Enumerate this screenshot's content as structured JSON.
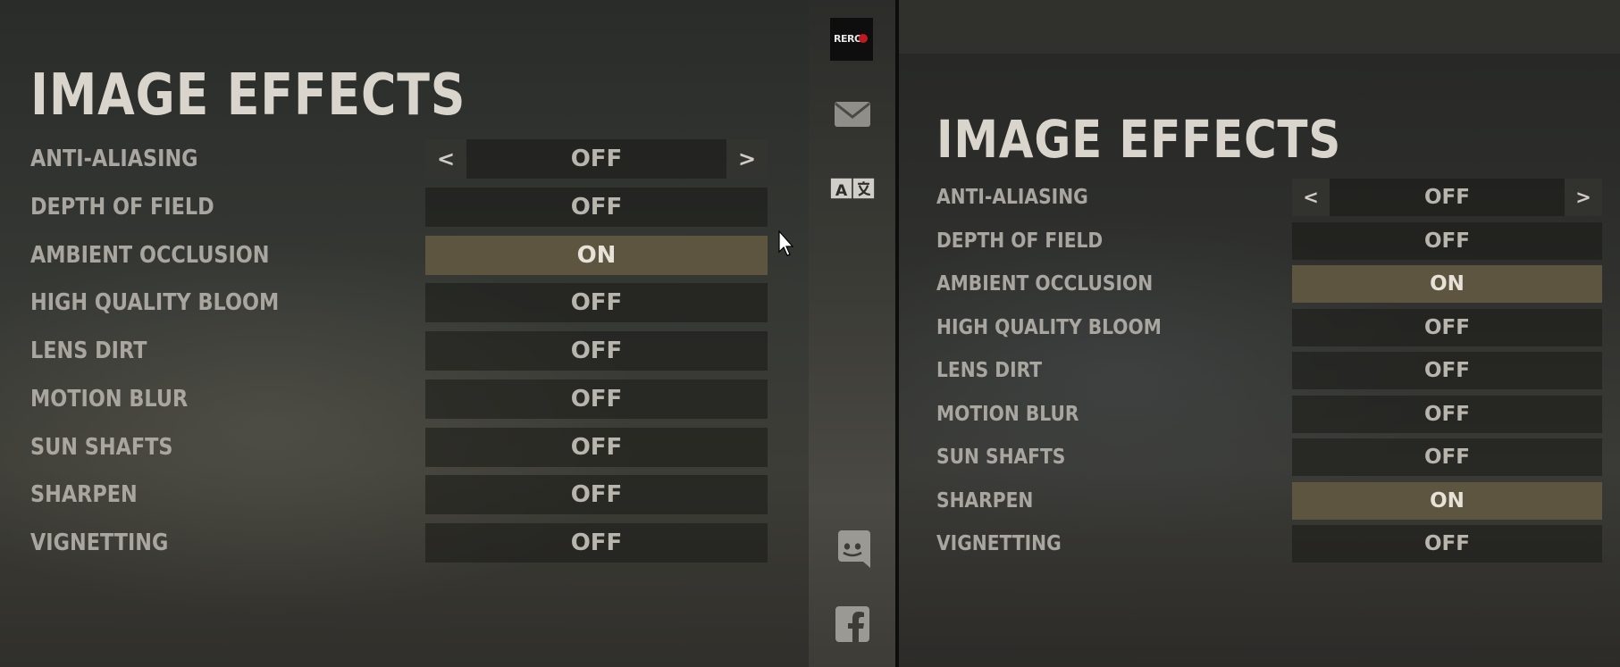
{
  "left": {
    "title": "IMAGE EFFECTS",
    "settings": [
      {
        "label": "ANTI-ALIASING",
        "value": "OFF",
        "arrows": true,
        "on": false
      },
      {
        "label": "DEPTH OF FIELD",
        "value": "OFF",
        "arrows": false,
        "on": false
      },
      {
        "label": "AMBIENT OCCLUSION",
        "value": "ON",
        "arrows": false,
        "on": true
      },
      {
        "label": "HIGH QUALITY BLOOM",
        "value": "OFF",
        "arrows": false,
        "on": false
      },
      {
        "label": "LENS DIRT",
        "value": "OFF",
        "arrows": false,
        "on": false
      },
      {
        "label": "MOTION BLUR",
        "value": "OFF",
        "arrows": false,
        "on": false
      },
      {
        "label": "SUN SHAFTS",
        "value": "OFF",
        "arrows": false,
        "on": false
      },
      {
        "label": "SHARPEN",
        "value": "OFF",
        "arrows": false,
        "on": false
      },
      {
        "label": "VIGNETTING",
        "value": "OFF",
        "arrows": false,
        "on": false
      }
    ]
  },
  "right": {
    "title": "IMAGE EFFECTS",
    "settings": [
      {
        "label": "ANTI-ALIASING",
        "value": "OFF",
        "arrows": true,
        "on": false
      },
      {
        "label": "DEPTH OF FIELD",
        "value": "OFF",
        "arrows": false,
        "on": false
      },
      {
        "label": "AMBIENT OCCLUSION",
        "value": "ON",
        "arrows": false,
        "on": true
      },
      {
        "label": "HIGH QUALITY BLOOM",
        "value": "OFF",
        "arrows": false,
        "on": false
      },
      {
        "label": "LENS DIRT",
        "value": "OFF",
        "arrows": false,
        "on": false
      },
      {
        "label": "MOTION BLUR",
        "value": "OFF",
        "arrows": false,
        "on": false
      },
      {
        "label": "SUN SHAFTS",
        "value": "OFF",
        "arrows": false,
        "on": false
      },
      {
        "label": "SHARPEN",
        "value": "ON",
        "arrows": false,
        "on": true
      },
      {
        "label": "VIGNETTING",
        "value": "OFF",
        "arrows": false,
        "on": false
      }
    ]
  },
  "arrows": {
    "prev": "<",
    "next": ">"
  },
  "sidebar": {
    "logo_text": "RERO",
    "icons": [
      "logo-icon",
      "mail-icon",
      "translate-icon",
      "discord-icon",
      "facebook-icon"
    ]
  },
  "colors": {
    "on_bg": "#5d5540",
    "label": "#a8a69f",
    "title": "#d9d5cc"
  }
}
